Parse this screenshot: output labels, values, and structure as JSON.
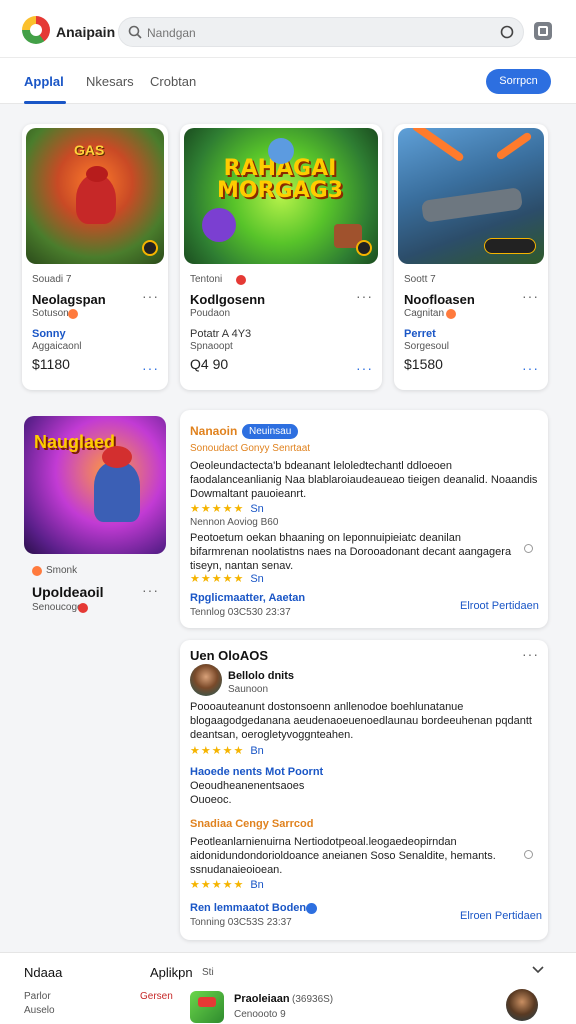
{
  "header": {
    "app_name": "Anaipain",
    "search_placeholder": "Nandgan"
  },
  "tabs": [
    {
      "label": "Applal",
      "active": true
    },
    {
      "label": "Nkesars",
      "active": false
    },
    {
      "label": "Crobtan",
      "active": false
    }
  ],
  "top_button": "Sorrpcn",
  "game_cards": [
    {
      "overline": "Souadi 7",
      "title": "Neolagspan",
      "sub": "Sotuson",
      "accent": "Sonny",
      "accent2": "Aggaicaonl",
      "price": "$1180",
      "thumb_text": "GAS"
    },
    {
      "overline": "Tentoni",
      "title": "Kodlgosenn",
      "sub": "Poudaon",
      "accent": "Potatr A 4Y3",
      "accent2": "Spnaoopt",
      "price": "Q4 90",
      "thumb_text": "RAHAGAI MORGAG3"
    },
    {
      "overline": "Soott 7",
      "title": "Noofloasen",
      "sub": "Cagnitan",
      "accent": "Perret",
      "accent2": "Sorgesoul",
      "price": "$1580",
      "thumb_text": ""
    }
  ],
  "featured": {
    "overline": "Smonk",
    "title": "Upoldeaoil",
    "sub": "Senoucogo",
    "thumb_text": "Nauglaed"
  },
  "review1": {
    "brand": "Nanaoin",
    "badge": "Neuinsau",
    "subline": "Sonoudact   Gonyy  Senrtaat",
    "para1": "Oeoleundactecta'b bdeanant leloledtechantl ddloeoen faodalanceanlianig Naa blablaroiaudeaueao tieigen deanalid. Noaandis Dowmaltant pauoieanrt.",
    "rating1": "Sn",
    "sub2": "Nennon  Aoviog  B60",
    "para2": "Peotoetum oekan bhaaning on leponnuipieiatc deanilan bifarmrenan noolatistns naes na Dorooadonant decant aangagera tiseyn, nantan senav.",
    "rating2": "Sn",
    "link_left": "Rpglicmaatter, Aaetan",
    "meta": "Tennlog 03C530 23:37",
    "link_right": "Elroot Pertidaen"
  },
  "review2": {
    "heading": "Uen OloAOS",
    "user_name": "Bellolo dnits",
    "user_sub": "Saunoon",
    "para1": "Poooauteanunt dostonsoenn anllenodoe boehlunatanue blogaagodgedanana aeudenaoeuenoedlaunau bordeeuhenan pqdantt deantsan, oerogletyvoggnteahen.",
    "rating1": "Bn",
    "link1": "Haoede nents  Mot  Poornt",
    "text1": "Oeoudheanenentsaoes",
    "text2": "Ouoeoc.",
    "orange_line": "Snadiaa  Cengy  Sarrcod",
    "para2": "Peotleanlarnienuirna Nertiodotpeoal.leogaedeopirndan aidonidundondorioldoance aneianen Soso Senaldite, hemants. ssnudanaieoioean.",
    "rating2": "Bn",
    "link_left": "Ren lemmaatot  Boden",
    "meta": "Tonning 03C53S 23:37",
    "link_right": "Elroen Pertidaen"
  },
  "bottom": {
    "left_title": "Ndaaa",
    "center_title": "Aplikpn",
    "center_sub": "Sti",
    "left_item1": "Parlor",
    "left_item2": "Auselo",
    "mid_label": "Gersen",
    "product_title": "Praoleiaan",
    "product_code": "(36936S)",
    "product_sub": "Cenoooto 9"
  },
  "colors": {
    "accent_blue": "#1a56c6",
    "button_blue": "#2d6fe0",
    "star": "#f5b400",
    "orange": "#e0821e"
  },
  "icons": {
    "search": "search-icon",
    "mic": "circle-icon",
    "extension": "extension-icon",
    "more": "more-horizontal-icon",
    "chevron": "chevron-down-icon"
  }
}
